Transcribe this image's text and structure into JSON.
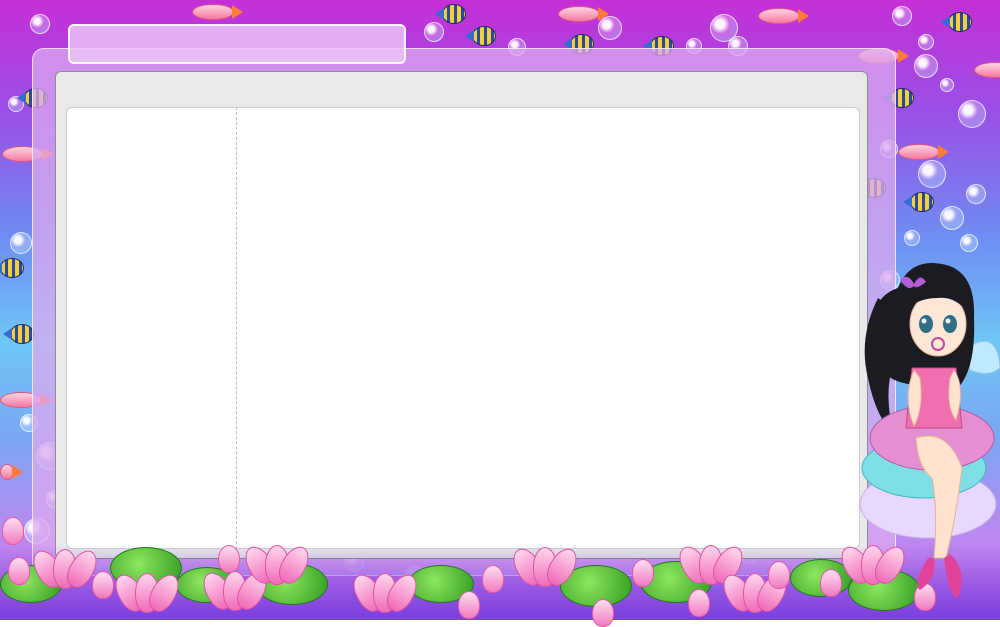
{
  "window": {
    "title": ""
  },
  "colors": {
    "background_top": "#c52fd6",
    "background_mid": "#6fc6f6",
    "frame": "#dcaaf0",
    "window_chrome": "#e9e9e9",
    "panel": "#ffffff"
  },
  "decor": {
    "character": "girl-with-bubble-wand",
    "fish_types": [
      "striped-tropical-fish",
      "pink-fish"
    ],
    "flowers": "pink-lotus"
  }
}
